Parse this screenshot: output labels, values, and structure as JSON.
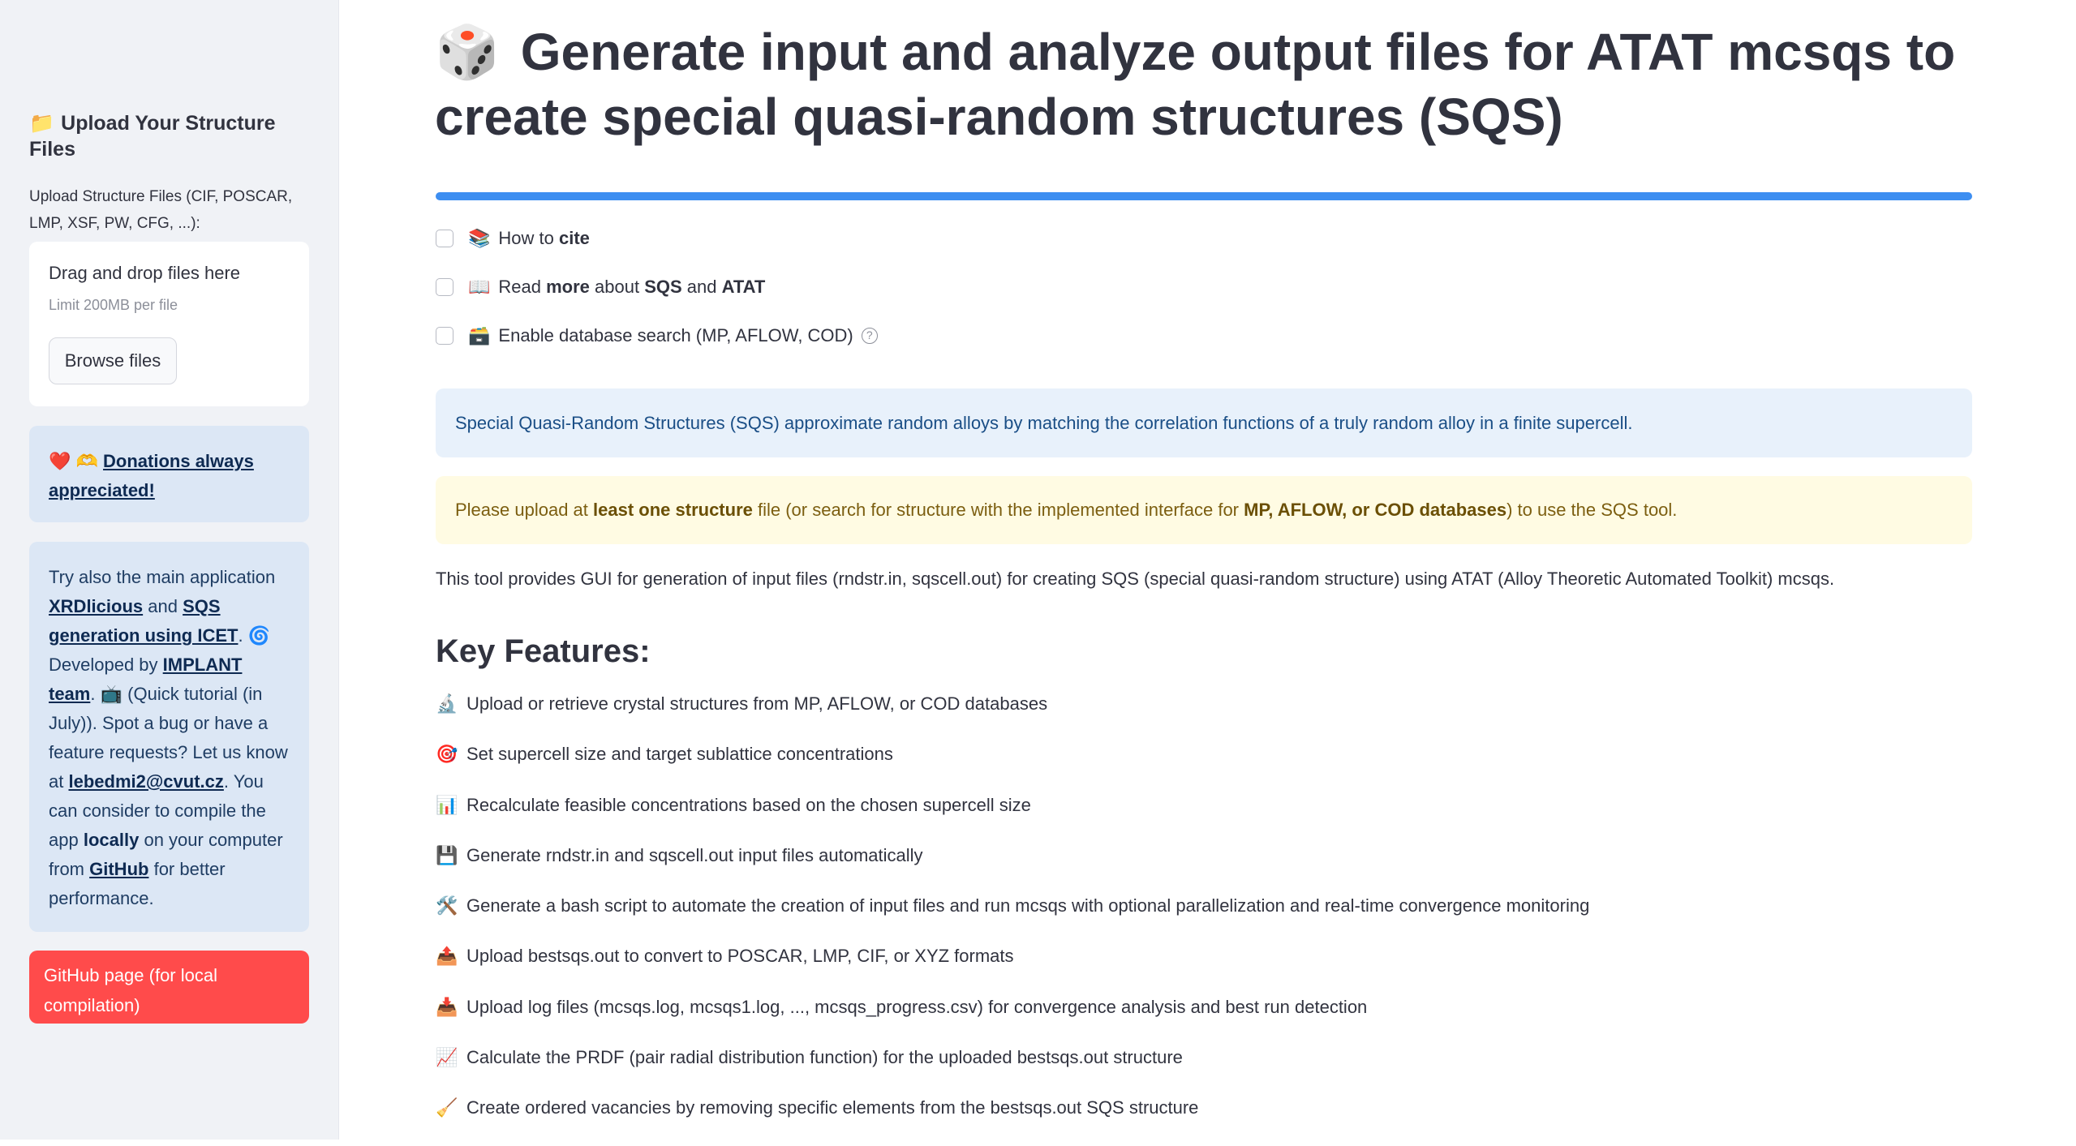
{
  "sidebar": {
    "upload_title_icon": "📁",
    "upload_title": "Upload Your Structure Files",
    "upload_label": "Upload Structure Files (CIF, POSCAR, LMP, XSF, PW, CFG, ...):",
    "dropzone_text": "Drag and drop files here",
    "dropzone_limit": "Limit 200MB per file",
    "browse_label": "Browse files",
    "donation_emoji": "❤️ 🫶",
    "donation_link": "Donations always appreciated!",
    "info": {
      "p1": "Try also the main application",
      "link_xrd": "XRDlicious",
      "and": "and",
      "link_sqs": "SQS generation using ICET",
      "dot1": ".",
      "spiral": "🌀",
      "developed_by": "Developed by",
      "link_implant": "IMPLANT team",
      "dot2": ".",
      "tv": "📺",
      "tutorial": "(Quick tutorial (in July)). Spot a bug or have a feature requests? Let us know at",
      "email": "lebedmi2@cvut.cz",
      "consider": ". You can consider to compile the app",
      "locally": "locally",
      "on_computer": "on your computer from",
      "github": "GitHub",
      "better": "for better performance."
    },
    "github_button": "GitHub page (for local compilation)"
  },
  "main": {
    "title_icon": "🎲",
    "title": "Generate input and analyze output files for ATAT mcsqs to create special quasi-random structures (SQS)",
    "accent_color": "#3d8ef1",
    "checkboxes": [
      {
        "icon": "📚",
        "pre": "How to ",
        "bold": "cite",
        "checked": false
      },
      {
        "icon": "📖",
        "pre": "Read ",
        "bold": "more",
        "mid": " about ",
        "bold2": "SQS",
        "mid2": " and ",
        "bold3": "ATAT",
        "checked": false
      },
      {
        "icon": "🗃️",
        "pre": "Enable database search (MP, AFLOW, COD)",
        "checked": false,
        "help_icon": "question-circle-icon"
      }
    ],
    "info_alert": "Special Quasi-Random Structures (SQS) approximate random alloys by matching the correlation functions of a truly random alloy in a finite supercell.",
    "warning": {
      "p1": "Please upload at ",
      "b1": "least one structure",
      "p2": " file (or search for structure with the implemented interface for ",
      "b2": "MP, AFLOW, or COD databases",
      "p3": ") to use the SQS tool."
    },
    "description": "This tool provides GUI for generation of input files (rndstr.in, sqscell.out) for creating SQS (special quasi-random structure) using ATAT (Alloy Theoretic Automated Toolkit) mcsqs.",
    "key_features_title": "Key Features:",
    "features": [
      {
        "icon": "🔬",
        "text": "Upload or retrieve crystal structures from MP, AFLOW, or COD databases"
      },
      {
        "icon": "🎯",
        "text": "Set supercell size and target sublattice concentrations"
      },
      {
        "icon": "📊",
        "text": "Recalculate feasible concentrations based on the chosen supercell size"
      },
      {
        "icon": "💾",
        "text": "Generate rndstr.in and sqscell.out input files automatically"
      },
      {
        "icon": "🛠️",
        "text": "Generate a bash script to automate the creation of input files and run mcsqs with optional parallelization and real-time convergence monitoring"
      },
      {
        "icon": "📤",
        "text": "Upload bestsqs.out to convert to POSCAR, LMP, CIF, or XYZ formats"
      },
      {
        "icon": "📥",
        "text": "Upload log files (mcsqs.log, mcsqs1.log, ..., mcsqs_progress.csv) for convergence analysis and best run detection"
      },
      {
        "icon": "📈",
        "text": "Calculate the PRDF (pair radial distribution function) for the uploaded bestsqs.out structure"
      },
      {
        "icon": "🧹",
        "text": "Create ordered vacancies by removing specific elements from the bestsqs.out SQS structure"
      }
    ]
  }
}
